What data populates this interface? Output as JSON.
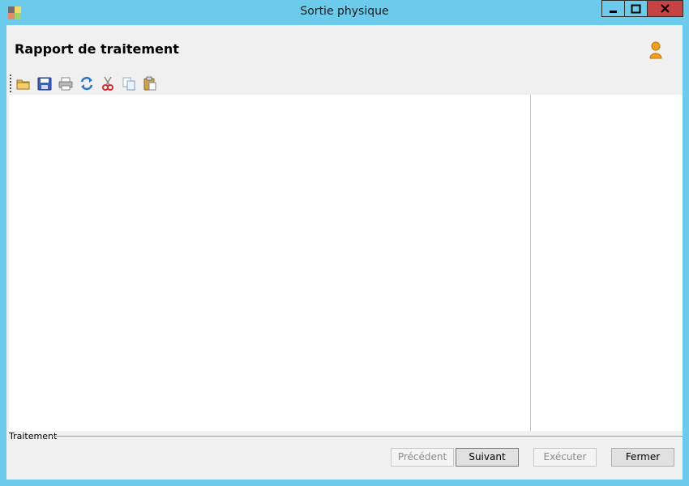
{
  "window": {
    "title": "Sortie physique",
    "controls": {
      "minimize": "minimize-icon",
      "maximize": "maximize-icon",
      "close": "close-icon"
    }
  },
  "header": {
    "title": "Rapport de traitement",
    "user_icon": "user-icon"
  },
  "toolbar": {
    "items": [
      "open-folder-icon",
      "save-icon",
      "print-icon",
      "refresh-icon",
      "cut-icon",
      "copy-icon",
      "paste-icon"
    ]
  },
  "group": {
    "label": "Traitement"
  },
  "buttons": {
    "previous": "Précédent",
    "next": "Suivant",
    "execute": "Exécuter",
    "close": "Fermer"
  },
  "colors": {
    "titlebar": "#6ccbea",
    "close_button": "#c74242",
    "client": "#f0f0f0"
  }
}
